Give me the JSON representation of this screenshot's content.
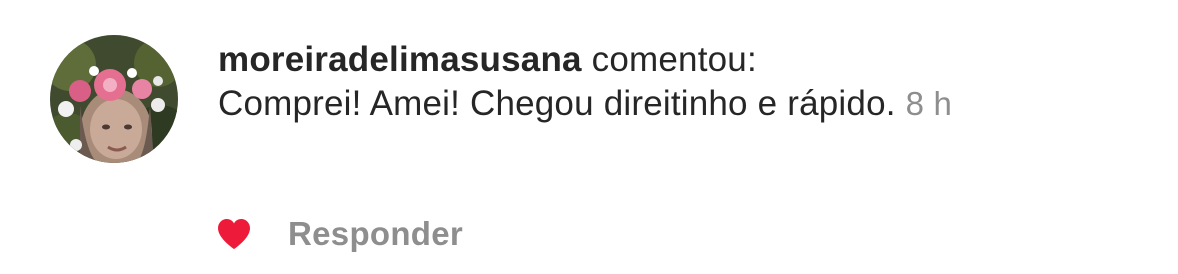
{
  "comment": {
    "username": "moreiradelimasusana",
    "action": "comentou:",
    "text": "Comprei! Amei! Chegou direitinho e rápido.",
    "timestamp": "8 h",
    "reply_label": "Responder",
    "liked": true,
    "avatar_icon": "user-avatar-photo",
    "like_icon": "heart-icon"
  },
  "colors": {
    "text": "#262626",
    "secondary": "#8e8e8e",
    "like": "#ed1a3a",
    "background": "#ffffff"
  }
}
